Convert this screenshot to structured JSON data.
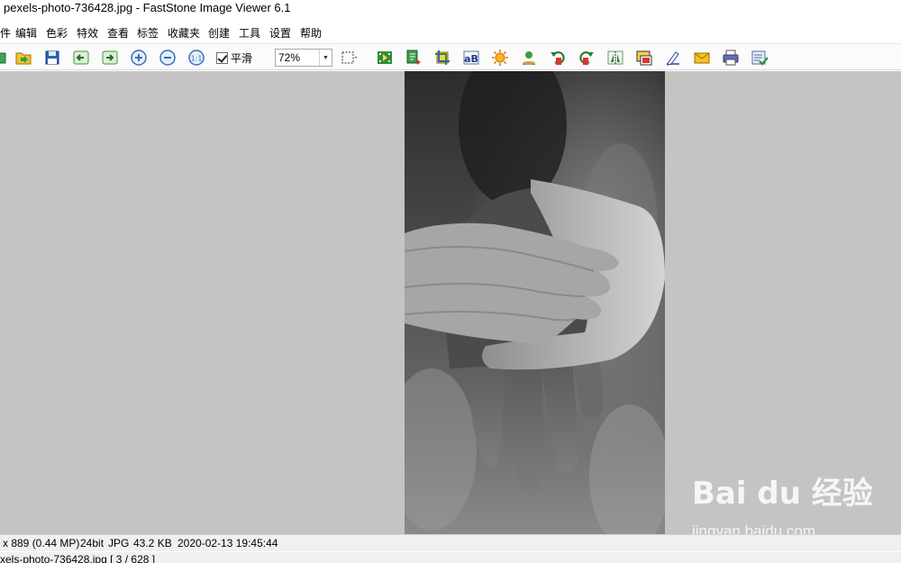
{
  "window": {
    "title": "pexels-photo-736428.jpg  -  FastStone Image Viewer 6.1"
  },
  "menu": [
    "件",
    "编辑",
    "色彩",
    "特效",
    "查看",
    "标签",
    "收藏夹",
    "创建",
    "工具",
    "设置",
    "帮助"
  ],
  "toolbar": {
    "smooth_label": "平滑",
    "smooth_checked": true,
    "zoom_value": "72%",
    "icons": [
      "open-folder-icon",
      "browse-icon",
      "save-icon",
      "previous-image-icon",
      "next-image-icon",
      "zoom-in-icon",
      "zoom-out-icon",
      "actual-size-icon",
      "select-region-icon",
      "slideshow-icon",
      "batch-convert-icon",
      "crop-icon",
      "text-icon",
      "adjust-lighting-icon",
      "red-eye-icon",
      "rotate-left-icon",
      "rotate-right-icon",
      "flip-icon",
      "screen-capture-icon",
      "draw-icon",
      "email-icon",
      "print-icon",
      "settings-check-icon"
    ]
  },
  "status": {
    "dimensions": "x 889 (0.44 MP)",
    "bitdepth": "24bit",
    "format": "JPG",
    "filesize": "43.2 KB",
    "datetime": "2020-02-13 19:45:44",
    "file_info": "xels-photo-736428.jpg [ 3 / 628 ]"
  },
  "watermark": {
    "logo": "Bai du 经验",
    "url": "jingyan.baidu.com"
  },
  "colors": {
    "viewer_background": "#c4c4c4",
    "status_background": "#f0f0f0"
  }
}
